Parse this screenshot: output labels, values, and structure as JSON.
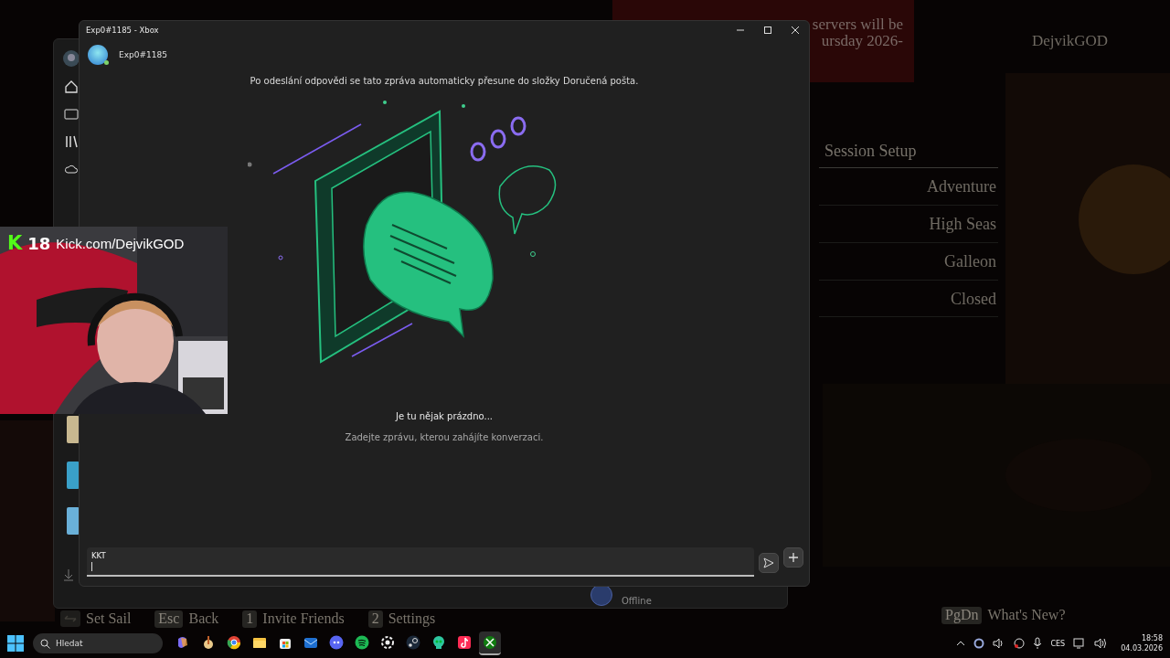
{
  "game": {
    "banner": [
      "servers will be",
      "ursday 2026-"
    ],
    "player": "DejvikGOD",
    "menu_title": "Session Setup",
    "menu_items": [
      "Adventure",
      "High Seas",
      "Galleon",
      "Closed"
    ],
    "hints": [
      {
        "label": "Set Sail"
      },
      {
        "key": "Esc",
        "label": "Back"
      },
      {
        "key": "1",
        "label": "Invite Friends"
      },
      {
        "key": "2",
        "label": "Settings"
      }
    ],
    "corner_hint": {
      "key": "PgDn",
      "label": "What's New?"
    }
  },
  "background_app": {
    "friend_status": "Offline"
  },
  "window": {
    "title": "Exp0#1185 - Xbox",
    "contact": "Exp0#1185",
    "notice": "Po odeslání odpovědi se tato zpráva automaticky přesune do složky Doručená pošta.",
    "empty_title": "Je tu nějak prázdno...",
    "empty_hint": "Zadejte zprávu, kterou zahájíte konverzaci.",
    "message": {
      "value": "KKT"
    }
  },
  "stream_overlay": {
    "badge": "K",
    "age": "18",
    "url": "Kick.com/DejvikGOD"
  },
  "taskbar": {
    "search": {
      "placeholder": "Hledat"
    },
    "apps": [
      {
        "kind": "copilot",
        "selected": false
      },
      {
        "kind": "torch",
        "selected": false
      },
      {
        "kind": "browser",
        "selected": false
      },
      {
        "kind": "folder",
        "selected": false
      },
      {
        "kind": "store",
        "selected": false
      },
      {
        "kind": "mail",
        "selected": false
      },
      {
        "kind": "chat",
        "selected": false
      },
      {
        "kind": "music",
        "selected": false
      },
      {
        "kind": "gear",
        "selected": false
      },
      {
        "kind": "steam",
        "selected": false
      },
      {
        "kind": "skull",
        "selected": false
      },
      {
        "kind": "note",
        "selected": false
      },
      {
        "kind": "xbox",
        "selected": true
      }
    ],
    "language": "CES",
    "time": "18:58",
    "date": "04.03.2026"
  }
}
